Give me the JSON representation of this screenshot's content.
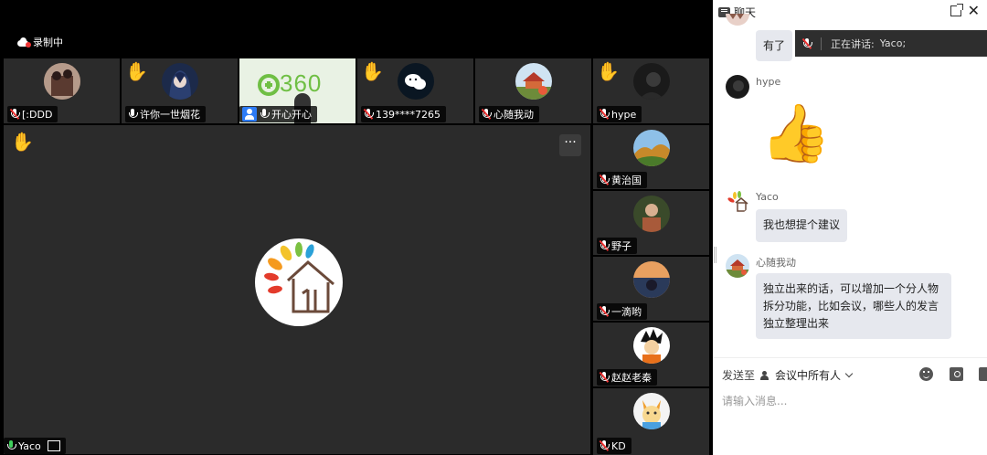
{
  "recording": {
    "label": "录制中"
  },
  "participants_top": [
    {
      "name": "[:DDD",
      "muted": true,
      "hand": false
    },
    {
      "name": "许你一世烟花",
      "muted": false,
      "hand": true
    },
    {
      "name": "开心开心",
      "muted": false,
      "hand": false,
      "host": true
    },
    {
      "name": "139****7265",
      "muted": true,
      "hand": true
    },
    {
      "name": "心随我动",
      "muted": true,
      "hand": false
    },
    {
      "name": "hype",
      "muted": true,
      "hand": true
    }
  ],
  "screen_share_brand": "360",
  "participants_side": [
    {
      "name": "黄治国",
      "muted": true
    },
    {
      "name": "野子",
      "muted": true
    },
    {
      "name": "一滴哟",
      "muted": true
    },
    {
      "name": "赵赵老秦",
      "muted": true
    },
    {
      "name": "KD",
      "muted": true
    }
  ],
  "main_speaker": {
    "name": "Yaco",
    "more": "···"
  },
  "chat": {
    "title": "聊天",
    "close": "✕",
    "speaking_prefix": "正在讲话:",
    "speaking_name": "Yaco;",
    "messages": [
      {
        "sender": "",
        "text": "有了"
      },
      {
        "sender": "hype",
        "text": "👍"
      },
      {
        "sender": "Yaco",
        "text": "我也想提个建议"
      },
      {
        "sender": "心随我动",
        "text": "独立出来的话，可以增加一个分人物拆分功能，比如会议，哪些人的发言独立整理出来"
      }
    ],
    "send_to_label": "发送至",
    "send_to_target": "会议中所有人",
    "input_placeholder": "请输入消息..."
  }
}
